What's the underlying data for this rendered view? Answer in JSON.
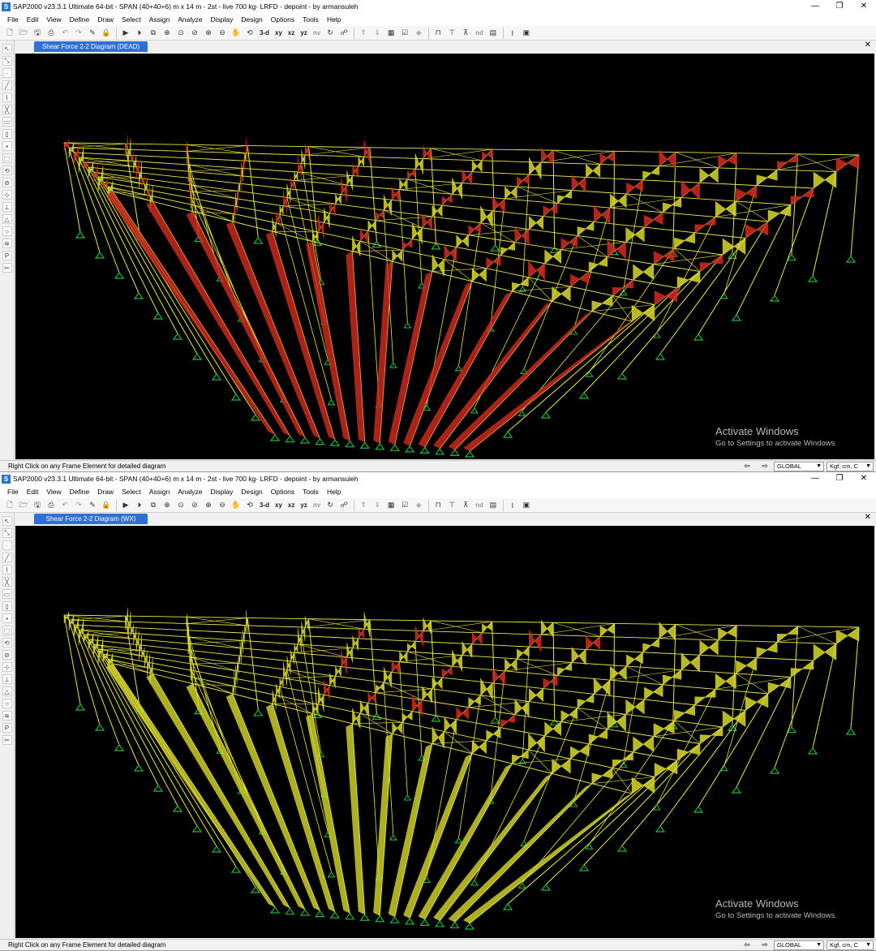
{
  "app": {
    "title": "SAP2000 v23.3.1 Ultimate 64-bit - SPAN (40+40+6) m  x 14 m - 2st - live 700 kg- LRFD - depoint - by armansuleh",
    "icon_letter": "S",
    "window_controls": [
      "—",
      "❐",
      "✕"
    ]
  },
  "menu": [
    "File",
    "Edit",
    "View",
    "Define",
    "Draw",
    "Select",
    "Assign",
    "Analyze",
    "Display",
    "Design",
    "Options",
    "Tools",
    "Help"
  ],
  "toolbar": {
    "view_3d": "3-d",
    "view_xy": "xy",
    "view_xz": "xz",
    "view_yz": "yz",
    "view_nv": "nv",
    "nd": "nd"
  },
  "windows": [
    {
      "tab_title": "Shear Force 2-2 Diagram (DEAD)",
      "status_text": "Right Click on any Frame Element for detailed diagram",
      "coord_system": "GLOBAL",
      "units": "Kgf, cm, C",
      "scheme": "dead"
    },
    {
      "tab_title": "Shear Force 2-2 Diagram (WX)",
      "status_text": "Right Click on any Frame Element for detailed diagram",
      "coord_system": "GLOBAL",
      "units": "Kgf, cm, C",
      "scheme": "wx"
    }
  ],
  "activation": {
    "title": "Activate Windows",
    "subtitle": "Go to Settings to activate Windows."
  },
  "colors": {
    "frame": "#e9e94a",
    "diagram_positive": "#d42a1e",
    "diagram_negative": "#d9d92a",
    "support": "#1fb83a",
    "background": "#000000",
    "tab": "#2f6fd6"
  },
  "icons": {
    "window_controls": [
      "minimize-icon",
      "maximize-icon",
      "close-icon"
    ]
  }
}
